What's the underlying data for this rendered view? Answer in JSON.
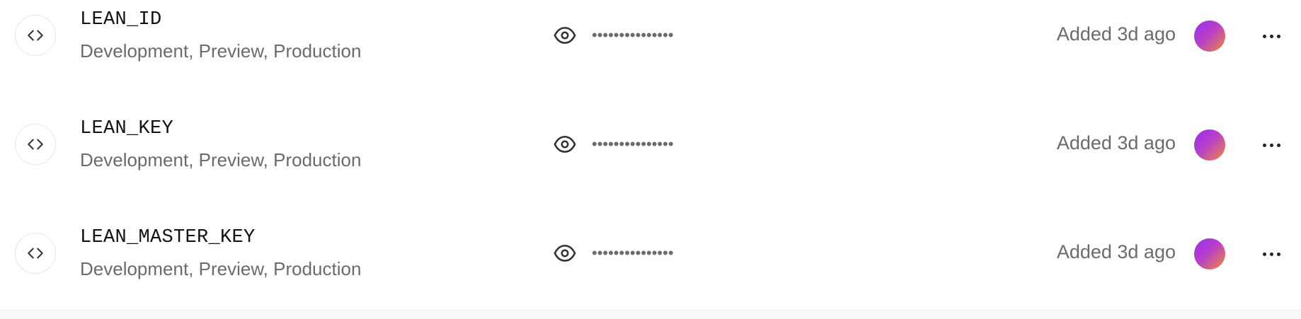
{
  "variables": [
    {
      "name": "LEAN_ID",
      "environments": "Development, Preview, Production",
      "masked_value": "•••••••••••••••",
      "added": "Added 3d ago"
    },
    {
      "name": "LEAN_KEY",
      "environments": "Development, Preview, Production",
      "masked_value": "•••••••••••••••",
      "added": "Added 3d ago"
    },
    {
      "name": "LEAN_MASTER_KEY",
      "environments": "Development, Preview, Production",
      "masked_value": "•••••••••••••••",
      "added": "Added 3d ago"
    }
  ],
  "icons": {
    "row_icon": "code-brackets-icon",
    "reveal": "eye-icon",
    "menu": "more-horizontal-icon"
  },
  "colors": {
    "text_primary": "#111111",
    "text_secondary": "#6b6b6b",
    "avatar_gradient_start": "#9b2cf0",
    "avatar_gradient_end": "#f08a3c"
  }
}
